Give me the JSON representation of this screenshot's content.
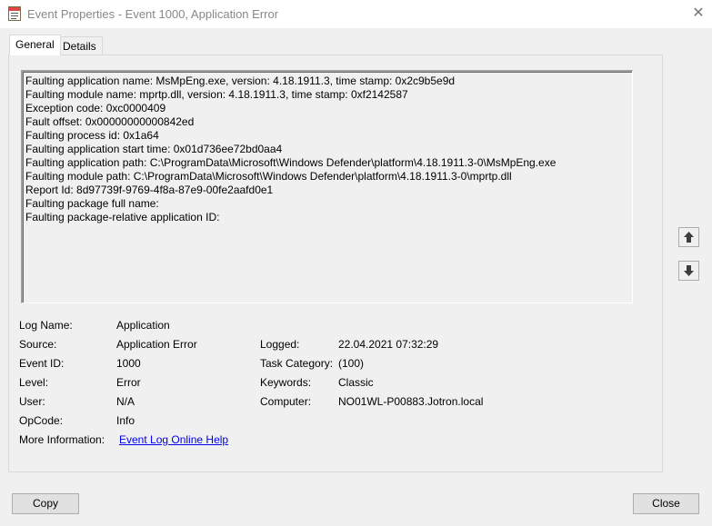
{
  "window": {
    "title": "Event Properties - Event 1000, Application Error",
    "close_glyph": "✕"
  },
  "tabs": [
    {
      "label": "General"
    },
    {
      "label": "Details"
    }
  ],
  "description_lines": [
    "Faulting application name: MsMpEng.exe, version: 4.18.1911.3, time stamp: 0x2c9b5e9d",
    "Faulting module name: mprtp.dll, version: 4.18.1911.3, time stamp: 0xf2142587",
    "Exception code: 0xc0000409",
    "Fault offset: 0x00000000000842ed",
    "Faulting process id: 0x1a64",
    "Faulting application start time: 0x01d736ee72bd0aa4",
    "Faulting application path: C:\\ProgramData\\Microsoft\\Windows Defender\\platform\\4.18.1911.3-0\\MsMpEng.exe",
    "Faulting module path: C:\\ProgramData\\Microsoft\\Windows Defender\\platform\\4.18.1911.3-0\\mprtp.dll",
    "Report Id: 8d97739f-9769-4f8a-87e9-00fe2aafd0e1",
    "Faulting package full name:",
    "Faulting package-relative application ID:"
  ],
  "fields": {
    "log_name": {
      "label": "Log Name:",
      "value": "Application"
    },
    "source": {
      "label": "Source:",
      "value": "Application Error"
    },
    "logged": {
      "label": "Logged:",
      "value": "22.04.2021 07:32:29"
    },
    "event_id": {
      "label": "Event ID:",
      "value": "1000"
    },
    "task_category": {
      "label": "Task Category:",
      "value": "(100)"
    },
    "level": {
      "label": "Level:",
      "value": "Error"
    },
    "keywords": {
      "label": "Keywords:",
      "value": "Classic"
    },
    "user": {
      "label": "User:",
      "value": "N/A"
    },
    "computer": {
      "label": "Computer:",
      "value": "NO01WL-P00883.Jotron.local"
    },
    "opcode": {
      "label": "OpCode:",
      "value": "Info"
    },
    "more_info": {
      "label": "More Information:",
      "link": "Event Log Online Help"
    }
  },
  "buttons": {
    "copy": "Copy",
    "close": "Close"
  },
  "icons": {
    "app": "event-log-icon",
    "up": "arrow-up-icon",
    "down": "arrow-down-icon"
  }
}
